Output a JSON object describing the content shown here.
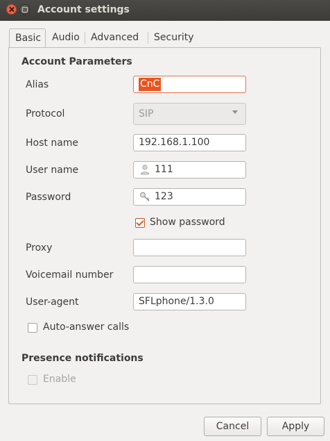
{
  "window": {
    "title": "Account settings"
  },
  "tabs": [
    "Basic",
    "Audio",
    "Advanced",
    "Security"
  ],
  "account": {
    "section_title": "Account Parameters",
    "alias_label": "Alias",
    "alias_value": "CnC",
    "protocol_label": "Protocol",
    "protocol_value": "SIP",
    "host_label": "Host name",
    "host_value": "192.168.1.100",
    "user_label": "User name",
    "user_value": "111",
    "user_icon": "person-icon",
    "password_label": "Password",
    "password_value": "123",
    "password_icon": "key-icon",
    "show_password_label": "Show password",
    "show_password_checked": true,
    "proxy_label": "Proxy",
    "proxy_value": "",
    "voicemail_label": "Voicemail number",
    "voicemail_value": "",
    "useragent_label": "User-agent",
    "useragent_value": "SFLphone/1.3.0",
    "autoanswer_label": "Auto-answer calls",
    "autoanswer_checked": false
  },
  "presence": {
    "section_title": "Presence notifications",
    "enable_label": "Enable",
    "enable_checked": false,
    "enable_disabled": true
  },
  "buttons": {
    "cancel": "Cancel",
    "apply": "Apply"
  },
  "colors": {
    "accent": "#e95420",
    "titlebar": "#3c3b37",
    "background": "#f2f1f0"
  }
}
